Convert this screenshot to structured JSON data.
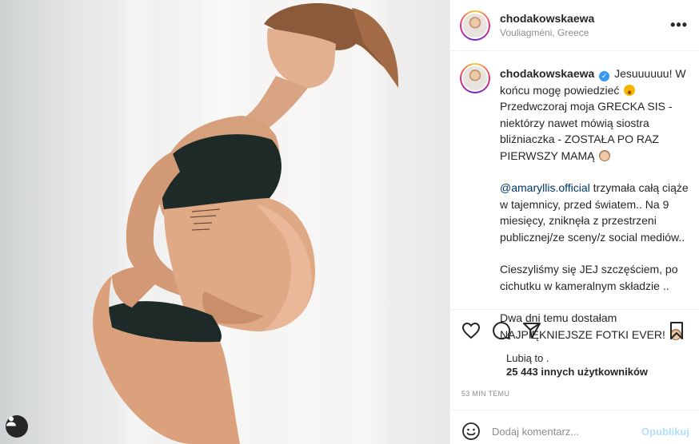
{
  "post": {
    "username": "chodakowskaewa",
    "location": "Vouliagméni, Greece",
    "more_icon": "more-options-icon"
  },
  "caption": {
    "username": "chodakowskaewa",
    "verified": "✓",
    "p1": "Jesuuuuuu! W końcu mogę powiedzieć",
    "p1b": "Przedwczoraj moja GRECKA SIS - niektórzy nawet mówią siostra bliźniaczka - ZOSTAŁA PO RAZ PIERWSZY MAMĄ",
    "mention": "@amaryllis.official",
    "p2": "trzymała całą ciąże w tajemnicy, przed światem.. Na 9 miesięcy, zniknęła z przestrzeni publicznej/ze sceny/z social mediów..",
    "p3": "Cieszyliśmy się JEJ szczęściem, po cichutku w kameralnym składzie ..",
    "p4": "Dwa dni temu dostałam NAJPIĘKNIEJSZE FOTKI EVER!"
  },
  "likes": {
    "line1": "Lubią to .",
    "line2": "25 443 innych użytkowników"
  },
  "time": "53 MIN TEMU",
  "comment": {
    "placeholder": "Dodaj komentarz...",
    "publish": "Opublikuj"
  },
  "colors": {
    "verified": "#3897f0",
    "mention": "#00376b",
    "publish_disabled": "#b2dffc"
  }
}
